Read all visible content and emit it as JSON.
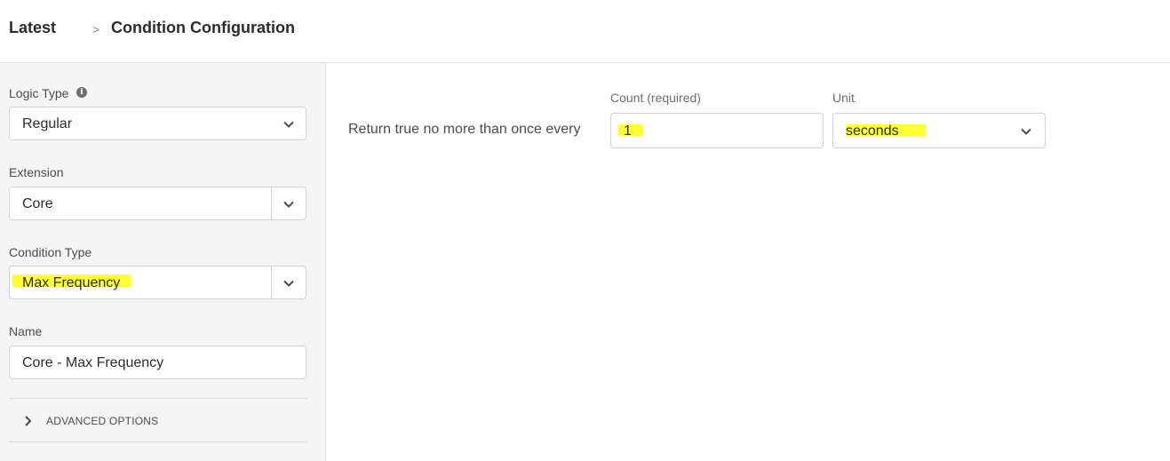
{
  "breadcrumb": {
    "root": "Latest",
    "separator": ">",
    "current": "Condition Configuration"
  },
  "sidebar": {
    "logic_type": {
      "label": "Logic Type",
      "info_icon": "i",
      "value": "Regular"
    },
    "extension": {
      "label": "Extension",
      "value": "Core"
    },
    "condition_type": {
      "label": "Condition Type",
      "value": "Max Frequency"
    },
    "name": {
      "label": "Name",
      "value": "Core - Max Frequency"
    },
    "advanced_options": {
      "label": "ADVANCED OPTIONS"
    }
  },
  "main": {
    "sentence": "Return true no more than once every",
    "count": {
      "label": "Count (required)",
      "value": "1"
    },
    "unit": {
      "label": "Unit",
      "value": "seconds"
    }
  },
  "colors": {
    "highlight": "#ffff33",
    "sidebar_bg": "#f5f5f5",
    "border": "#d3d3d3"
  },
  "icons": [
    "chevron-right-icon",
    "info-icon",
    "chevron-down-icon"
  ]
}
